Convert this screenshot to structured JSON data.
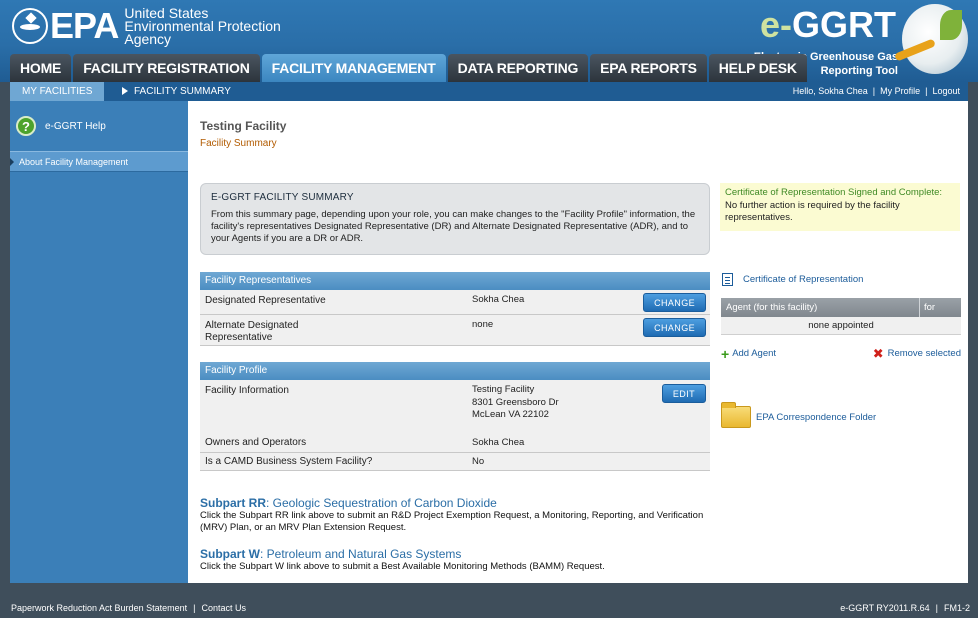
{
  "header": {
    "epa_letters": "EPA",
    "agency_lines": [
      "United States",
      "Environmental Protection",
      "Agency"
    ],
    "app_name_prefix": "e-",
    "app_name": "GGRT",
    "tagline": [
      "Electronic Greenhouse Gas",
      "Reporting Tool"
    ]
  },
  "tabs": [
    {
      "label": "HOME",
      "active": false
    },
    {
      "label": "FACILITY REGISTRATION",
      "active": false
    },
    {
      "label": "FACILITY MANAGEMENT",
      "active": true
    },
    {
      "label": "DATA REPORTING",
      "active": false
    },
    {
      "label": "EPA REPORTS",
      "active": false
    },
    {
      "label": "HELP DESK",
      "active": false
    }
  ],
  "subnav": {
    "my_facilities": "MY FACILITIES",
    "facility_summary": "FACILITY SUMMARY",
    "greeting": "Hello, Sokha Chea",
    "my_profile": "My Profile",
    "logout": "Logout",
    "sep": "|"
  },
  "sidebar": {
    "help_icon": "?",
    "help_label": "e-GGRT Help",
    "about_label": "About Facility Management"
  },
  "main": {
    "title": "Testing Facility",
    "subtitle": "Facility Summary",
    "summary": {
      "heading": "E-GGRT FACILITY SUMMARY",
      "text": "From this summary page, depending upon your role, you can make changes to the \"Facility Profile\" information, the facility's representatives Designated Representative (DR) and Alternate Designated Representative (ADR), and to your Agents if you are a DR or ADR."
    },
    "cert_note": {
      "highlight": "Certificate of Representation Signed and Complete:",
      "text": " No further action is required by the facility representatives."
    },
    "representatives": {
      "heading": "Facility Representatives",
      "dr_label": "Designated Representative",
      "dr_value": "Sokha Chea",
      "adr_label": "Alternate Designated Representative",
      "adr_value": "none",
      "change_label": "CHANGE"
    },
    "profile": {
      "heading": "Facility Profile",
      "info_label": "Facility Information",
      "info_lines": [
        "Testing Facility",
        "8301 Greensboro Dr",
        "McLean VA 22102"
      ],
      "edit_label": "EDIT",
      "owners_label": "Owners and Operators",
      "owners_value": "Sokha Chea",
      "camd_label": "Is a CAMD Business System Facility?",
      "camd_value": "No"
    },
    "subparts": [
      {
        "code": "Subpart RR",
        "name": ": Geologic Sequestration of Carbon Dioxide",
        "text": "Click the Subpart RR link above to submit an R&D Project Exemption Request, a Monitoring, Reporting, and Verification (MRV) Plan, or an MRV Plan Extension Request."
      },
      {
        "code": "Subpart W",
        "name": ": Petroleum and Natural Gas Systems",
        "text": "Click the Subpart W link above to submit a Best Available Monitoring Methods (BAMM) Request."
      }
    ],
    "right": {
      "cert_link": "Certificate of Representation",
      "agent_col1": "Agent (for this facility)",
      "agent_col2": "for",
      "agent_empty": "none appointed",
      "add_agent": "Add Agent",
      "remove_selected": "Remove selected",
      "folder_link": "EPA Correspondence Folder"
    }
  },
  "footer": {
    "paperwork": "Paperwork Reduction Act Burden Statement",
    "contact": "Contact Us",
    "version": "e-GGRT RY2011.R.64",
    "page_id": "FM1-2",
    "sep": "|"
  },
  "colors": {
    "header_blue": "#2a6ea8",
    "tab_active": "#3b86c0",
    "sidebar_blue": "#3b7fb8",
    "button_blue": "#1f6bb3",
    "link_blue": "#1c5c9a",
    "subtitle_orange": "#b25b00",
    "cert_green": "#3f8a25"
  }
}
